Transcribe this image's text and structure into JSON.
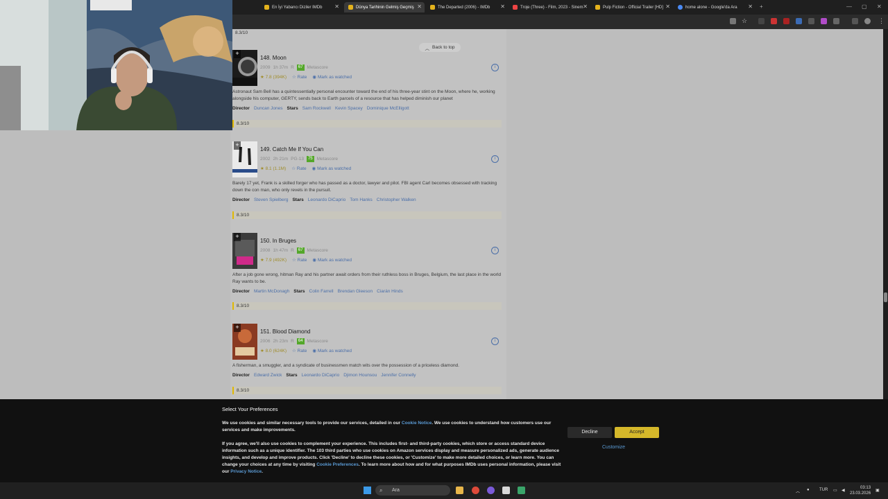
{
  "tabs": [
    {
      "title": "En İyi Yabancı Diziler IMDb",
      "color": "#e3b21c"
    },
    {
      "title": "Dünya Tarihinin Gelmiş Geçmiş",
      "color": "#e3b21c",
      "active": true
    },
    {
      "title": "The Departed (2006) - IMDb",
      "color": "#e3b21c"
    },
    {
      "title": "Troje (Three) - Film, 2023 - Sinem",
      "color": "#e44"
    },
    {
      "title": "Pulp Fiction - Official Trailer [HD]",
      "color": "#e3b21c"
    },
    {
      "title": "home alone - Google'da Ara",
      "color": "#4a8af4"
    }
  ],
  "back_to_top": "Back to top",
  "top_rating": "8.3/10",
  "items": [
    {
      "title": "148. Moon",
      "year": "2009",
      "runtime": "1h 37m",
      "cert": "R",
      "metascore": "67",
      "metascore_label": "Metascore",
      "rating": "7.8 (394K)",
      "rate": "Rate",
      "watched": "Mark as watched",
      "plot": "Astronaut Sam Bell has a quintessentially personal encounter toward the end of his three-year stint on the Moon, where he, working alongside his computer, GERTY, sends back to Earth parcels of a resource that has helped diminish our planet",
      "director_label": "Director",
      "director": "Duncan Jones",
      "stars_label": "Stars",
      "stars": [
        "Sam Rockwell",
        "Kevin Spacey",
        "Dominique McElligott"
      ],
      "rating_bar": "8.3/10"
    },
    {
      "title": "149. Catch Me If You Can",
      "year": "2002",
      "runtime": "2h 21m",
      "cert": "PG-13",
      "metascore": "75",
      "metascore_label": "Metascore",
      "rating": "8.1 (1.1M)",
      "rate": "Rate",
      "watched": "Mark as watched",
      "plot": "Barely 17 yet, Frank is a skilled forger who has passed as a doctor, lawyer and pilot. FBI agent Carl becomes obsessed with tracking down the con man, who only revels in the pursuit.",
      "director_label": "Director",
      "director": "Steven Spielberg",
      "stars_label": "Stars",
      "stars": [
        "Leonardo DiCaprio",
        "Tom Hanks",
        "Christopher Walken"
      ],
      "rating_bar": "8.3/10"
    },
    {
      "title": "150. In Bruges",
      "year": "2008",
      "runtime": "1h 47m",
      "cert": "R",
      "metascore": "67",
      "metascore_label": "Metascore",
      "rating": "7.9 (492K)",
      "rate": "Rate",
      "watched": "Mark as watched",
      "plot": "After a job gone wrong, hitman Ray and his partner await orders from their ruthless boss in Bruges, Belgium, the last place in the world Ray wants to be.",
      "director_label": "Director",
      "director": "Martin McDonagh",
      "stars_label": "Stars",
      "stars": [
        "Colin Farrell",
        "Brendan Gleeson",
        "Ciarán Hinds"
      ],
      "rating_bar": "8.3/10"
    },
    {
      "title": "151. Blood Diamond",
      "year": "2006",
      "runtime": "2h 23m",
      "cert": "R",
      "metascore": "64",
      "metascore_label": "Metascore",
      "rating": "8.0 (624K)",
      "rate": "Rate",
      "watched": "Mark as watched",
      "plot": "A fisherman, a smuggler, and a syndicate of businessmen match wits over the possession of a priceless diamond.",
      "director_label": "Director",
      "director": "Edward Zwick",
      "stars_label": "Stars",
      "stars": [
        "Leonardo DiCaprio",
        "Djimon Hounsou",
        "Jennifer Connelly"
      ],
      "rating_bar": "8.3/10"
    }
  ],
  "cookie": {
    "title": "Select Your Preferences",
    "p1_a": "We use cookies and similar necessary tools to provide our services, detailed in our ",
    "p1_link": "Cookie Notice",
    "p1_b": ". We use cookies to understand how customers use our services and make improvements.",
    "p2_a": "If you agree, we'll also use cookies to complement your experience. This includes first- and third-party cookies, which store or access standard device information such as a unique identifier. The 103 third parties who use cookies on Amazon services display and measure personalized ads, generate audience insights, and develop and improve products. Click 'Decline' to decline these cookies, or 'Customize' to make more detailed choices, or learn more. You can change your choices at any time by visiting ",
    "p2_link": "Cookie Preferences",
    "p2_b": ". To learn more about how and for what purposes IMDb uses personal information, please visit our ",
    "p2_link2": "Privacy Notice",
    "p2_c": ".",
    "decline": "Decline",
    "accept": "Accept",
    "customize": "Customize"
  },
  "taskbar": {
    "search_placeholder": "Ara",
    "lang": "TUR",
    "time": "03:13",
    "date": "23.03.2026"
  }
}
